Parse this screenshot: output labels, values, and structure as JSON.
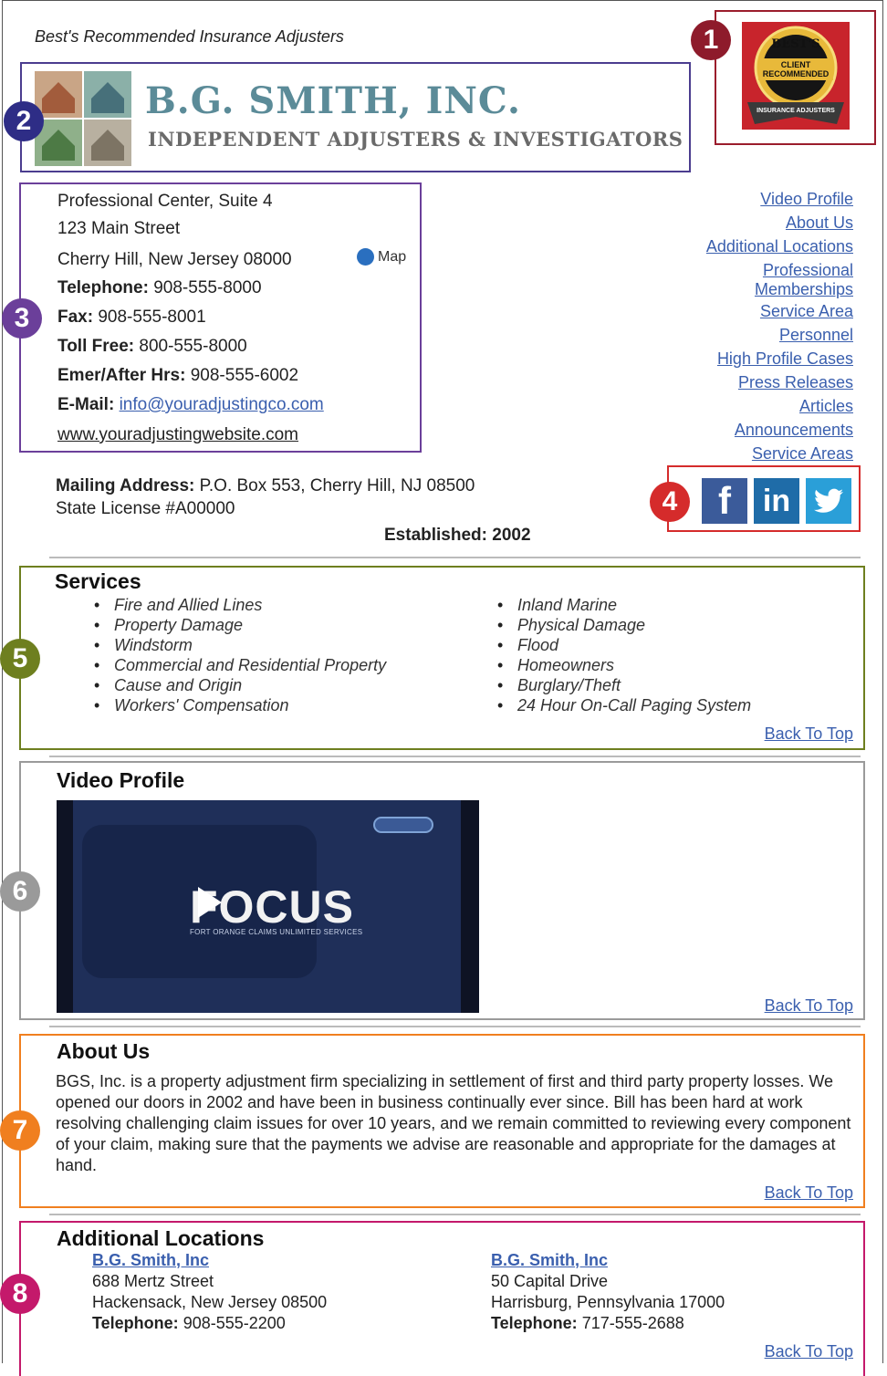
{
  "tagline": "Best's Recommended Insurance Adjusters",
  "callouts": [
    "1",
    "2",
    "3",
    "4",
    "5",
    "6",
    "7",
    "8"
  ],
  "badge": {
    "top_word": "BEST'S",
    "line1": "CLIENT",
    "line2": "RECOMMENDED",
    "ribbon": "INSURANCE ADJUSTERS"
  },
  "logo": {
    "name": "B.G. SMITH, INC.",
    "subtitle": "INDEPENDENT ADJUSTERS & INVESTIGATORS"
  },
  "contact": {
    "line1": "Professional Center, Suite 4",
    "line2": "123 Main Street",
    "line3": "Cherry Hill, New Jersey 08000",
    "map_label": "Map",
    "telephone_label": "Telephone:",
    "telephone": "908-555-8000",
    "fax_label": "Fax:",
    "fax": "908-555-8001",
    "tollfree_label": "Toll Free:",
    "tollfree": "800-555-8000",
    "emer_label": "Emer/After Hrs:",
    "emer": "908-555-6002",
    "email_label": "E-Mail:",
    "email": "info@youradjustingco.com",
    "website": "www.youradjustingwebsite.com"
  },
  "nav": {
    "video_profile": "Video Profile",
    "about_us": "About Us",
    "additional_locations": "Additional Locations",
    "prof_1": "Professional",
    "prof_2": "Memberships",
    "service_area": "Service Area",
    "personnel": "Personnel",
    "high_profile": "High Profile Cases",
    "press": "Press Releases",
    "articles": "Articles",
    "announcements": "Announcements",
    "service_areas": "Service Areas"
  },
  "mailing": {
    "label": "Mailing Address:",
    "value": "P.O. Box 553, Cherry Hill, NJ 08500",
    "license": "State License #A00000"
  },
  "established": "Established: 2002",
  "social": {
    "facebook": "f",
    "linkedin": "in",
    "twitter": "t"
  },
  "back_to_top": "Back To Top",
  "services": {
    "title": "Services",
    "left": [
      "Fire and Allied Lines",
      "Property Damage",
      "Windstorm",
      "Commercial and Residential Property",
      "Cause and Origin",
      "Workers' Compensation"
    ],
    "right": [
      "Inland Marine",
      "Physical Damage",
      "Flood",
      "Homeowners",
      "Burglary/Theft",
      "24 Hour On-Call Paging System"
    ]
  },
  "video": {
    "title": "Video Profile",
    "focus": "FOCUS",
    "sub": "FORT ORANGE CLAIMS UNLIMITED SERVICES"
  },
  "about": {
    "title": "About Us",
    "text": "BGS, Inc. is a property adjustment firm specializing in settlement of first and third party property losses. We opened our doors in 2002 and have been in business continually ever since. Bill has been hard at work resolving challenging claim issues for over 10 years, and we remain committed to reviewing every component of your claim, making sure that the payments we advise are reasonable and appropriate for the damages at hand."
  },
  "locations": {
    "title": "Additional Locations",
    "items": [
      {
        "name": "B.G. Smith, Inc",
        "street": "688 Mertz Street",
        "city": "Hackensack, New Jersey 08500",
        "tel_label": "Telephone:",
        "tel": "908-555-2200"
      },
      {
        "name": "B.G. Smith, Inc",
        "street": "50 Capital Drive",
        "city": "Harrisburg, Pennsylvania 17000",
        "tel_label": "Telephone:",
        "tel": "717-555-2688"
      }
    ]
  },
  "colors": {
    "c1": "#8e1b2b",
    "c2": "#2e2d86",
    "c3": "#6b3f9a",
    "c4": "#d52b2b",
    "c5": "#6e7f1f",
    "c6": "#9a9a9a",
    "c7": "#f07f1f",
    "c8": "#c4196b"
  }
}
